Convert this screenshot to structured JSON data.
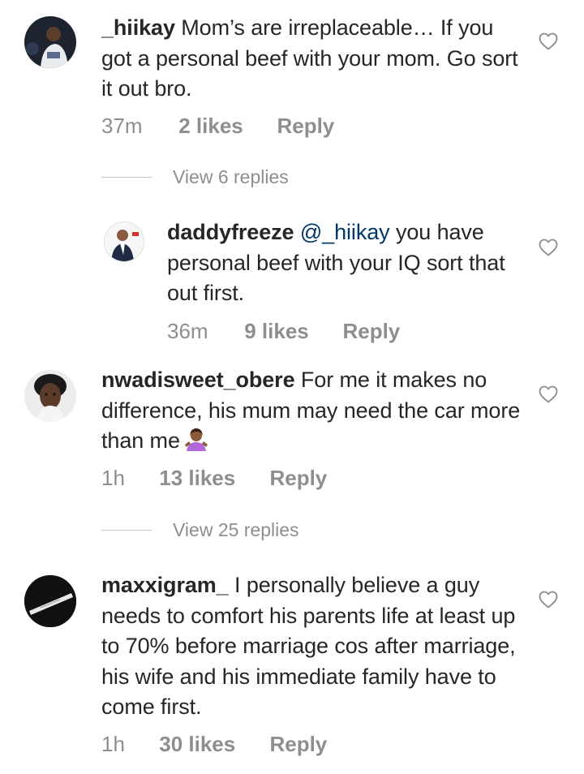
{
  "comments": [
    {
      "username": "_hiikay",
      "text": "Mom’s are irreplaceable… If you got a personal beef with your mom. Go sort it out bro.",
      "time": "37m",
      "likes": "2 likes",
      "reply": "Reply",
      "avatar_icon": "avatar-hiikay",
      "replies_label": "View 6 replies"
    },
    {
      "username": "daddyfreeze",
      "mention": "@_hiikay",
      "text": "you have personal beef with your IQ sort that out first.",
      "time": "36m",
      "likes": "9 likes",
      "reply": "Reply",
      "avatar_icon": "avatar-daddyfreeze"
    },
    {
      "username": "nwadisweet_obere",
      "text": "For me it makes no difference, his mum may need the car more than me",
      "emoji": "woman-shrugging-emoji",
      "time": "1h",
      "likes": "13 likes",
      "reply": "Reply",
      "avatar_icon": "avatar-nwadisweet",
      "replies_label": "View 25 replies"
    },
    {
      "username": "maxxigram_",
      "text": "I personally believe a guy needs to comfort his parents life at least up to 70% before marriage cos after marriage, his wife and his immediate family have to come first.",
      "time": "1h",
      "likes": "30 likes",
      "reply": "Reply",
      "avatar_icon": "avatar-maxxigram"
    }
  ],
  "colors": {
    "text": "#262626",
    "secondary": "#8e8e8e",
    "mention": "#00376b",
    "divider": "#c7c7c7"
  },
  "icons": {
    "like": "heart-outline-icon"
  }
}
